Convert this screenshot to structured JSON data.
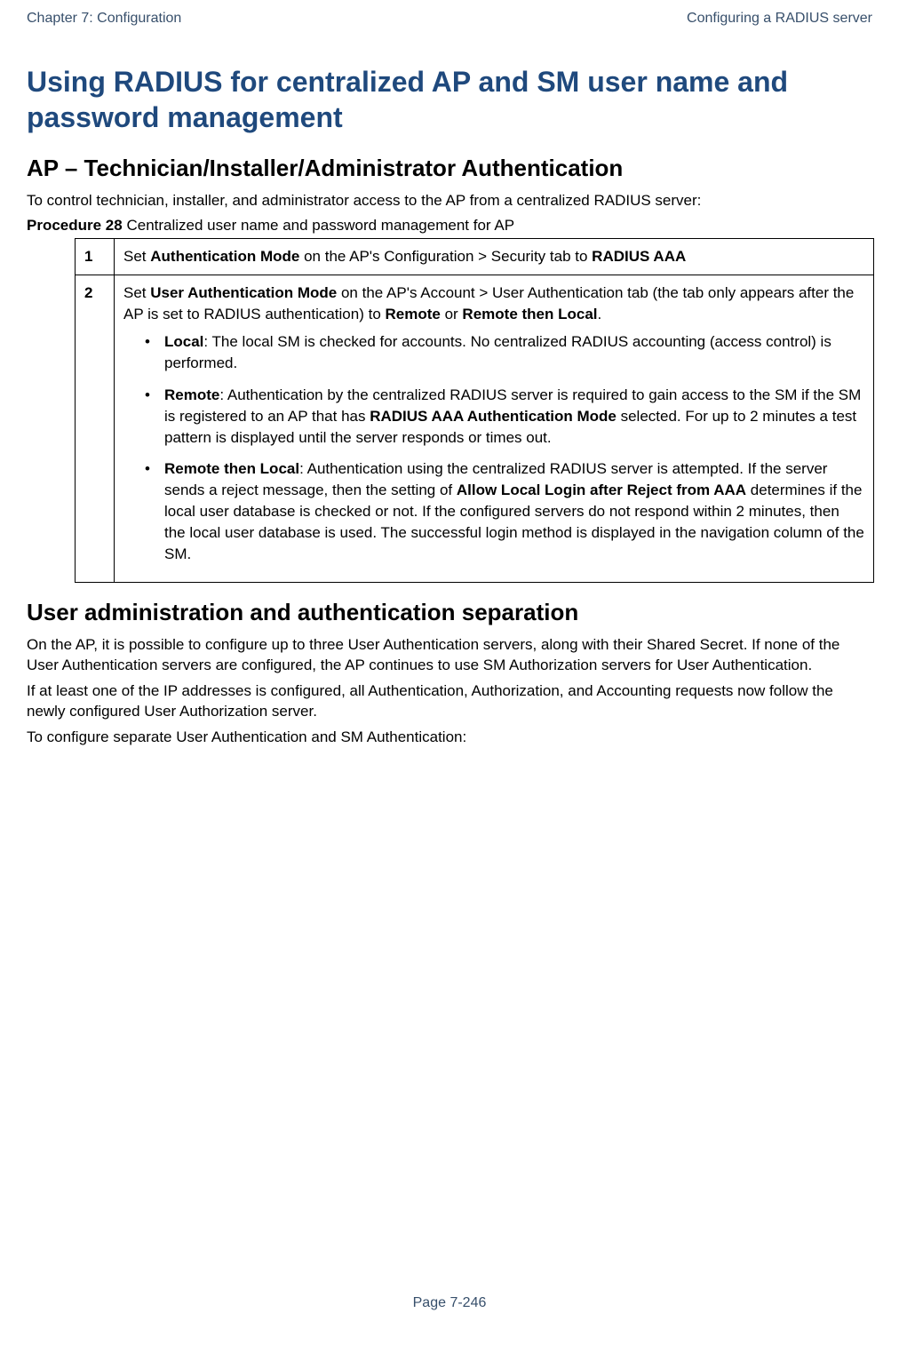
{
  "header": {
    "left": "Chapter 7:  Configuration",
    "right": "Configuring a RADIUS server"
  },
  "title": "Using RADIUS for centralized AP and SM user name and password management",
  "section1": {
    "heading": "AP – Technician/Installer/Administrator Authentication",
    "intro": "To control technician, installer, and administrator access to the AP from a centralized RADIUS server:",
    "procedure_label_bold": "Procedure 28",
    "procedure_label_rest": " Centralized user name and password management for AP"
  },
  "table": {
    "row1": {
      "num": "1",
      "pre": "Set ",
      "b1": "Authentication Mode",
      "mid": " on the AP's Configuration > Security tab to ",
      "b2": "RADIUS AAA"
    },
    "row2": {
      "num": "2",
      "para1_pre": "Set ",
      "para1_b1": "User Authentication Mode",
      "para1_mid": " on the AP's Account > User Authentication tab (the tab only appears after the AP is set to RADIUS authentication) to ",
      "para1_b2": "Remote",
      "para1_or": " or ",
      "para1_b3": "Remote then Local",
      "para1_end": ".",
      "bullet1_b": "Local",
      "bullet1_text": ": The local SM is checked for accounts. No centralized RADIUS accounting (access control) is performed.",
      "bullet2_b": "Remote",
      "bullet2_text_pre": ": Authentication by the centralized RADIUS server is required to gain access to the SM if the SM is registered to an AP that has ",
      "bullet2_b2": "RADIUS AAA Authentication Mode",
      "bullet2_text_post": " selected. For up to 2 minutes a test pattern is displayed until the server responds or times out.",
      "bullet3_b": "Remote then Local",
      "bullet3_text_pre": ": Authentication using the centralized RADIUS server is attempted. If the server sends a reject message, then the setting of ",
      "bullet3_b2": "Allow Local Login after Reject from AAA",
      "bullet3_text_post": " determines if the local user database is checked or not. If the configured servers do not respond within 2 minutes, then the local user database is used. The successful login method is displayed in the navigation column of the SM."
    }
  },
  "section2": {
    "heading": "User administration and authentication separation",
    "para1": "On the AP, it is possible to configure up to three User Authentication servers, along with their Shared Secret. If none of the User Authentication servers are configured, the AP continues to use SM Authorization servers for User Authentication.",
    "para2": "If at least one of the IP addresses is configured, all Authentication, Authorization, and Accounting requests now follow the newly configured User Authorization server.",
    "para3": "To configure separate User Authentication and SM Authentication:"
  },
  "footer": "Page 7-246"
}
